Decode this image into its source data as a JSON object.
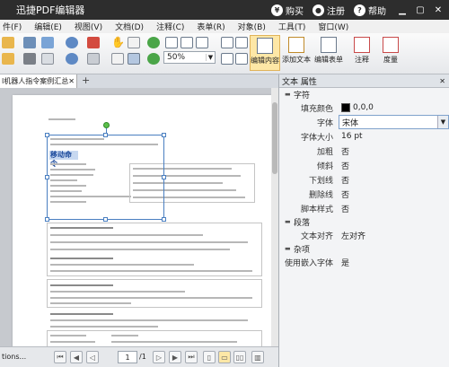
{
  "app": {
    "title": "迅捷PDF编辑器",
    "buy": "购买",
    "register": "注册",
    "help": "帮助"
  },
  "menu": [
    "件(F)",
    "编辑(E)",
    "视图(V)",
    "文档(D)",
    "注释(C)",
    "表单(R)",
    "对象(B)",
    "工具(T)",
    "窗口(W)"
  ],
  "toolbar": {
    "zoom": "50%",
    "edit_content": "编辑内容",
    "add_text": "添加文本",
    "edit_form": "编辑表单",
    "annotate": "注释",
    "measure": "度量"
  },
  "tab": {
    "name": "l机器人指令案例汇总"
  },
  "document": {
    "selected_heading": "移动命令"
  },
  "panel": {
    "title": "文本 属性",
    "section_font": "字符",
    "fill_color_label": "填充颜色",
    "fill_color_value": "0,0,0",
    "font_label": "字体",
    "font_value": "宋体",
    "font_size_label": "字体大小",
    "font_size_value": "16 pt",
    "bold_label": "加粗",
    "bold_value": "否",
    "italic_label": "倾斜",
    "italic_value": "否",
    "underline_label": "下划线",
    "underline_value": "否",
    "strike_label": "删除线",
    "strike_value": "否",
    "script_label": "脚本样式",
    "script_value": "否",
    "section_paragraph": "段落",
    "align_label": "文本对齐",
    "align_value": "左对齐",
    "section_misc": "杂项",
    "embed_label": "使用嵌入字体",
    "embed_value": "是"
  },
  "bottom": {
    "options": "tions...",
    "page_current": "1",
    "page_total": "/1"
  }
}
